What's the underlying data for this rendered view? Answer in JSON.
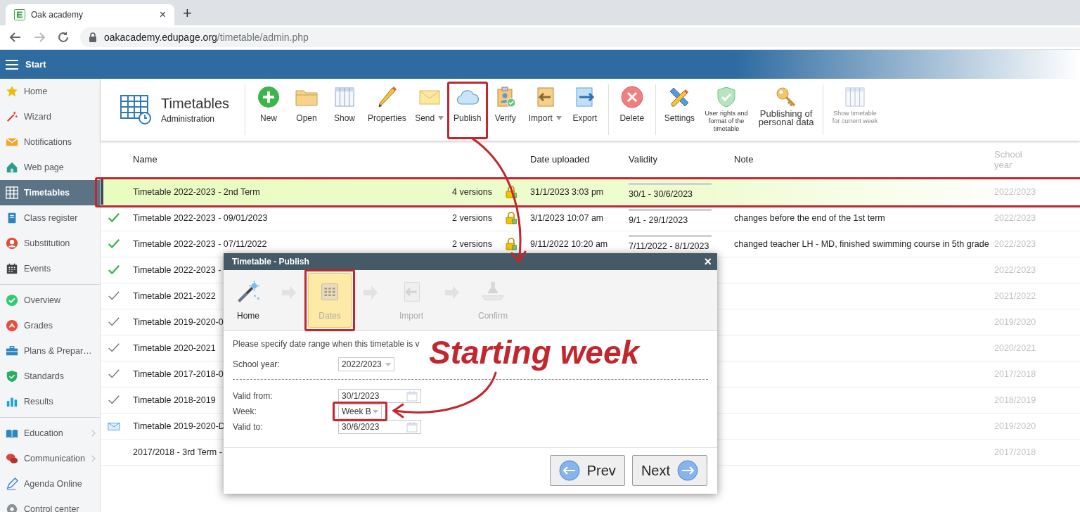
{
  "browser": {
    "tab_title": "Oak academy",
    "tab_close": "×",
    "new_tab": "+",
    "url_host": "oakacademy.edupage.org",
    "url_path": "/timetable/admin.php"
  },
  "topbar": {
    "title": "Start"
  },
  "sidebar": {
    "groups": [
      [
        {
          "label": "Home",
          "selected": false,
          "submenu": false
        },
        {
          "label": "Wizard",
          "selected": false,
          "submenu": false
        },
        {
          "label": "Notifications",
          "selected": false,
          "submenu": false
        },
        {
          "label": "Web page",
          "selected": false,
          "submenu": false
        },
        {
          "label": "Timetables",
          "selected": true,
          "submenu": false
        },
        {
          "label": "Class register",
          "selected": false,
          "submenu": false
        },
        {
          "label": "Substitution",
          "selected": false,
          "submenu": false
        },
        {
          "label": "Events",
          "selected": false,
          "submenu": false
        }
      ],
      [
        {
          "label": "Overview",
          "selected": false,
          "submenu": false
        },
        {
          "label": "Grades",
          "selected": false,
          "submenu": false
        },
        {
          "label": "Plans & Prepar…",
          "selected": false,
          "submenu": false
        },
        {
          "label": "Standards",
          "selected": false,
          "submenu": false
        },
        {
          "label": "Results",
          "selected": false,
          "submenu": false
        }
      ],
      [
        {
          "label": "Education",
          "selected": false,
          "submenu": true
        },
        {
          "label": "Communication",
          "selected": false,
          "submenu": true
        },
        {
          "label": "Agenda Online",
          "selected": false,
          "submenu": false
        },
        {
          "label": "Control center",
          "selected": false,
          "submenu": false
        }
      ]
    ]
  },
  "toolbar": {
    "title": "Timetables",
    "subtitle": "Administration",
    "groups": [
      [
        {
          "kind": "normal",
          "label": "New",
          "dropdown": false,
          "disabled": false,
          "circled": false
        },
        {
          "kind": "normal",
          "label": "Open",
          "dropdown": false,
          "disabled": false,
          "circled": false
        },
        {
          "kind": "normal",
          "label": "Show",
          "dropdown": false,
          "disabled": false,
          "circled": false
        },
        {
          "kind": "normal",
          "label": "Properties",
          "dropdown": false,
          "disabled": false,
          "circled": false
        },
        {
          "kind": "normal",
          "label": "Send",
          "dropdown": true,
          "disabled": false,
          "circled": false
        },
        {
          "kind": "normal",
          "label": "Publish",
          "dropdown": false,
          "disabled": false,
          "circled": true
        },
        {
          "kind": "normal",
          "label": "Verify",
          "dropdown": false,
          "disabled": false,
          "circled": false
        },
        {
          "kind": "normal",
          "label": "Import",
          "dropdown": true,
          "disabled": false,
          "circled": false
        },
        {
          "kind": "normal",
          "label": "Export",
          "dropdown": false,
          "disabled": false,
          "circled": false
        }
      ],
      [
        {
          "kind": "normal",
          "label": "Delete",
          "dropdown": false,
          "disabled": false,
          "circled": false
        }
      ],
      [
        {
          "kind": "normal",
          "label": "Settings",
          "dropdown": false,
          "disabled": false,
          "circled": false
        },
        {
          "kind": "small",
          "label": "User rights and format of the timetable",
          "dropdown": false,
          "disabled": false,
          "circled": false
        },
        {
          "kind": "large",
          "label": "Publishing of personal data",
          "dropdown": false,
          "disabled": false,
          "circled": false
        }
      ],
      [
        {
          "kind": "small",
          "label": "Show timetable for current week",
          "dropdown": false,
          "disabled": true,
          "circled": false
        }
      ]
    ]
  },
  "table": {
    "columns": [
      "Name",
      "Date uploaded",
      "Validity",
      "Note",
      "School year"
    ],
    "rows": [
      {
        "kind": "none",
        "name": "Timetable 2022-2023 - 2nd Term",
        "versions": "4 versions",
        "locked": true,
        "uploaded": "31/1/2023 3:03 pm",
        "validity": "30/1 - 30/6/2023",
        "school_year": "2022/2023",
        "selected": true,
        "circled": true
      },
      {
        "kind": "check_green",
        "name": "Timetable 2022-2023 - 09/01/2023",
        "versions": "2 versions",
        "locked": true,
        "uploaded": "3/1/2023 10:07 am",
        "validity": "9/1 - 29/1/2023",
        "note": "changes before the end of the 1st term",
        "school_year": "2022/2023",
        "selected": false,
        "circled": false
      },
      {
        "kind": "check_green",
        "name": "Timetable 2022-2023 - 07/11/2022",
        "versions": "2 versions",
        "locked": true,
        "uploaded": "9/11/2022 10:20 am",
        "validity": "7/11/2022 - 8/1/2023",
        "note": "changed teacher LH - MD, finished swimming course in 5th grade",
        "school_year": "2022/2023",
        "selected": false,
        "circled": false
      },
      {
        "kind": "check_green",
        "name": "Timetable 2022-2023 -",
        "school_year": "2022/2023",
        "selected": false,
        "circled": false
      },
      {
        "kind": "check_gray",
        "name": "Timetable 2021-2022",
        "school_year": "2021/2022",
        "selected": false,
        "circled": false
      },
      {
        "kind": "check_gray",
        "name": "Timetable 2019-2020-0",
        "school_year": "2019/2020",
        "selected": false,
        "circled": false
      },
      {
        "kind": "check_gray",
        "name": "Timetable 2020-2021",
        "school_year": "2020/2021",
        "selected": false,
        "circled": false
      },
      {
        "kind": "check_gray",
        "name": "Timetable 2017-2018-0",
        "school_year": "2017/2018",
        "selected": false,
        "circled": false
      },
      {
        "kind": "check_gray",
        "name": "Timetable 2018-2019",
        "school_year": "2018/2019",
        "selected": false,
        "circled": false
      },
      {
        "kind": "mail",
        "name": "Timetable 2019-2020-D",
        "school_year": "2019/2020",
        "selected": false,
        "circled": false
      },
      {
        "kind": "none",
        "name": "2017/2018 - 3rd Term -",
        "school_year": "2017/2018",
        "selected": false,
        "circled": false
      }
    ]
  },
  "dialog": {
    "title": "Timetable - Publish",
    "close": "×",
    "steps": [
      {
        "label": "Home",
        "selected": false,
        "disabled": false,
        "circled": false
      },
      {
        "label": "Dates",
        "selected": true,
        "disabled": false,
        "circled": true
      },
      {
        "label": "Import",
        "selected": false,
        "disabled": true,
        "circled": false
      },
      {
        "label": "Confirm",
        "selected": false,
        "disabled": true,
        "circled": false
      }
    ],
    "instruction": "Please specify date range when this timetable is v",
    "school_year": {
      "label": "School year:",
      "value": "2022/2023"
    },
    "fields": [
      {
        "kind": "date",
        "label": "Valid from:",
        "value": "30/1/2023",
        "circled": false
      },
      {
        "kind": "select",
        "label": "Week:",
        "value": "Week B",
        "circled": true
      },
      {
        "kind": "date",
        "label": "Valid to:",
        "value": "30/6/2023",
        "circled": false
      }
    ],
    "buttons": [
      {
        "kind": "prev",
        "label": "Prev"
      },
      {
        "kind": "next",
        "label": "Next"
      }
    ]
  },
  "annotation": {
    "callout": "Starting week"
  }
}
